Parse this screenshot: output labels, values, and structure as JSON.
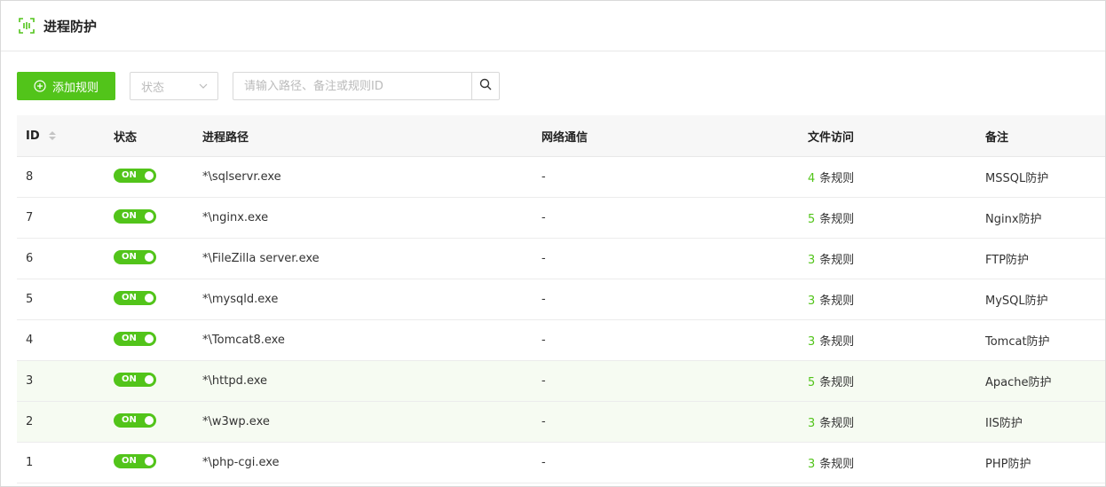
{
  "header": {
    "title": "进程防护",
    "icon": "scan-icon"
  },
  "toolbar": {
    "add_label": "添加规则",
    "status_select": "状态",
    "search_placeholder": "请输入路径、备注或规则ID"
  },
  "colors": {
    "accent": "#52c41a",
    "highlight_row": "#f6fbf2"
  },
  "table": {
    "columns": [
      "ID",
      "状态",
      "进程路径",
      "网络通信",
      "文件访问",
      "备注"
    ],
    "rows": [
      {
        "id": "8",
        "status": "ON",
        "path": "*\\sqlservr.exe",
        "net": "-",
        "file_count": "4",
        "file_suffix": "条规则",
        "note": "MSSQL防护"
      },
      {
        "id": "7",
        "status": "ON",
        "path": "*\\nginx.exe",
        "net": "-",
        "file_count": "5",
        "file_suffix": "条规则",
        "note": "Nginx防护"
      },
      {
        "id": "6",
        "status": "ON",
        "path": "*\\FileZilla server.exe",
        "net": "-",
        "file_count": "3",
        "file_suffix": "条规则",
        "note": "FTP防护"
      },
      {
        "id": "5",
        "status": "ON",
        "path": "*\\mysqld.exe",
        "net": "-",
        "file_count": "3",
        "file_suffix": "条规则",
        "note": "MySQL防护"
      },
      {
        "id": "4",
        "status": "ON",
        "path": "*\\Tomcat8.exe",
        "net": "-",
        "file_count": "3",
        "file_suffix": "条规则",
        "note": "Tomcat防护"
      },
      {
        "id": "3",
        "status": "ON",
        "path": "*\\httpd.exe",
        "net": "-",
        "file_count": "5",
        "file_suffix": "条规则",
        "note": "Apache防护"
      },
      {
        "id": "2",
        "status": "ON",
        "path": "*\\w3wp.exe",
        "net": "-",
        "file_count": "3",
        "file_suffix": "条规则",
        "note": "IIS防护"
      },
      {
        "id": "1",
        "status": "ON",
        "path": "*\\php-cgi.exe",
        "net": "-",
        "file_count": "3",
        "file_suffix": "条规则",
        "note": "PHP防护"
      }
    ]
  }
}
